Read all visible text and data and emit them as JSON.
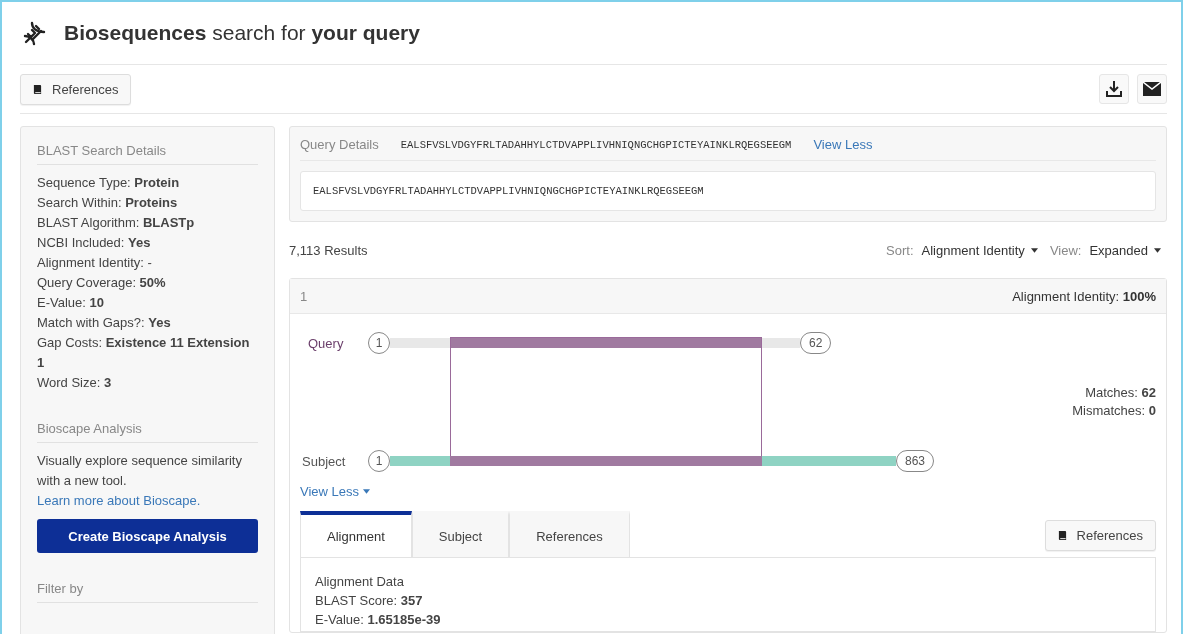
{
  "header": {
    "title": "**Biosequences** search for **your query**"
  },
  "toolbar": {
    "references_button": "References"
  },
  "sidebar": {
    "sections": [
      {
        "title": "BLAST Search Details",
        "kind": "details",
        "lines": [
          "Sequence Type: **Protein**",
          "Search Within: **Proteins**",
          "BLAST Algorithm: **BLASTp**",
          "NCBI Included: **Yes**",
          "Alignment Identity: -",
          "Query Coverage: **50%**",
          "E-Value: **10**",
          "Match with Gaps?: **Yes**",
          "Gap Costs: **Existence 11 Extension 1**",
          "Word Size: **3**"
        ]
      },
      {
        "title": "Bioscape Analysis",
        "kind": "promo",
        "text": "Visually explore sequence similarity with a new tool.",
        "link": "Learn more about Bioscape.",
        "button": "Create Bioscape Analysis"
      },
      {
        "title": "Filter by",
        "kind": "heading"
      }
    ]
  },
  "query": {
    "label": "Query Details",
    "sequence": "EALSFVSLVDGYFRLTADAHHYLCTDVAPPLIVHNIQNGCHGPICTEYAINKLRQEGSEEGM",
    "toggle": "View Less",
    "full_sequence": "EALSFVSLVDGYFRLTADAHHYLCTDVAPPLIVHNIQNGCHGPICTEYAINKLRQEGSEEGM"
  },
  "results": {
    "count": "7,113 Results",
    "sort_label": "Sort:",
    "sort_value": "Alignment Identity",
    "view_label": "View:",
    "view_value": "Expanded"
  },
  "result": {
    "index": "1",
    "identity": "Alignment Identity: **100%**",
    "query_track": {
      "label": "Query",
      "start": "1",
      "end": "62"
    },
    "subject_track": {
      "label": "Subject",
      "start": "1",
      "end": "863"
    },
    "matches": "Matches: **62**",
    "mismatches": "Mismatches: **0**",
    "toggle": "View Less",
    "tabs": [
      {
        "label": "Alignment",
        "selected": true
      },
      {
        "label": "Subject",
        "selected": false
      },
      {
        "label": "References",
        "selected": false
      }
    ],
    "references_button": "References",
    "alignment_lines": [
      "Alignment Data",
      "BLAST Score: **357**",
      "E-Value: **1.65185e-39**"
    ]
  }
}
